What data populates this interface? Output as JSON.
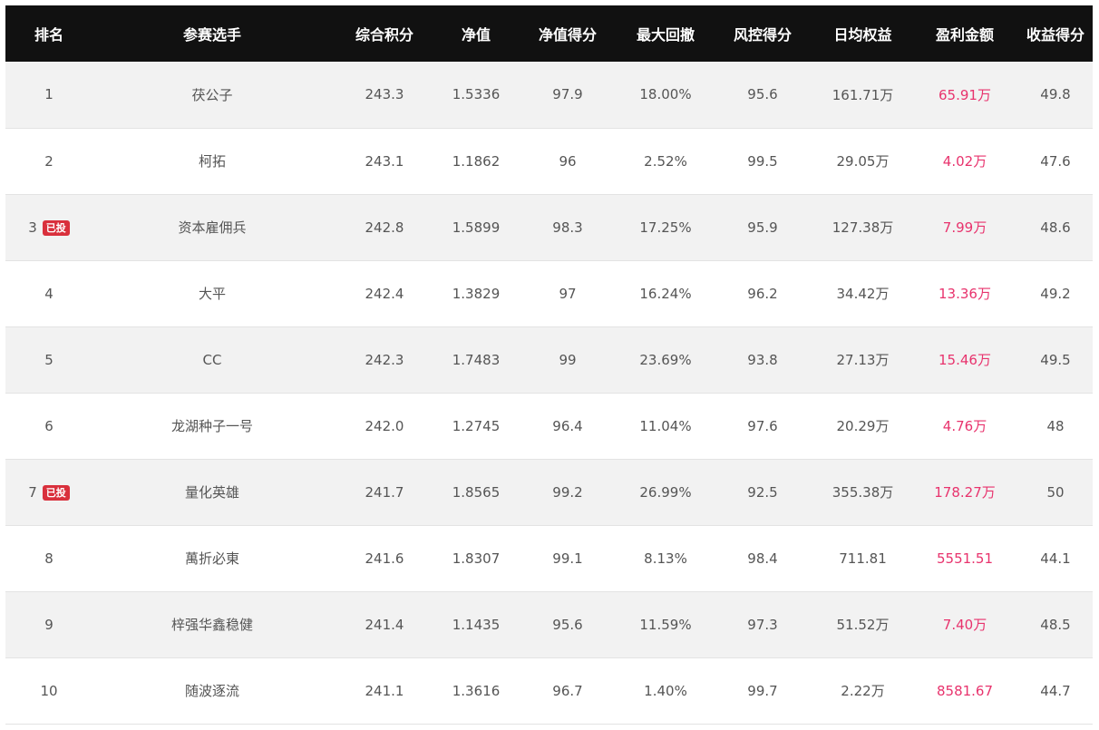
{
  "table": {
    "headers": [
      "排名",
      "参赛选手",
      "综合积分",
      "净值",
      "净值得分",
      "最大回撤",
      "风控得分",
      "日均权益",
      "盈利金额",
      "收益得分"
    ],
    "rows": [
      {
        "rank": "1",
        "badge": "",
        "name": "茯公子",
        "score": "243.3",
        "nav": "1.5336",
        "nav_score": "97.9",
        "drawdown": "18.00%",
        "risk_score": "95.6",
        "avg_equity": "161.71万",
        "profit": "65.91万",
        "return_score": "49.8"
      },
      {
        "rank": "2",
        "badge": "",
        "name": "柯拓",
        "score": "243.1",
        "nav": "1.1862",
        "nav_score": "96",
        "drawdown": "2.52%",
        "risk_score": "99.5",
        "avg_equity": "29.05万",
        "profit": "4.02万",
        "return_score": "47.6"
      },
      {
        "rank": "3",
        "badge": "已投",
        "name": "资本雇佣兵",
        "score": "242.8",
        "nav": "1.5899",
        "nav_score": "98.3",
        "drawdown": "17.25%",
        "risk_score": "95.9",
        "avg_equity": "127.38万",
        "profit": "7.99万",
        "return_score": "48.6"
      },
      {
        "rank": "4",
        "badge": "",
        "name": "大平",
        "score": "242.4",
        "nav": "1.3829",
        "nav_score": "97",
        "drawdown": "16.24%",
        "risk_score": "96.2",
        "avg_equity": "34.42万",
        "profit": "13.36万",
        "return_score": "49.2"
      },
      {
        "rank": "5",
        "badge": "",
        "name": "CC",
        "score": "242.3",
        "nav": "1.7483",
        "nav_score": "99",
        "drawdown": "23.69%",
        "risk_score": "93.8",
        "avg_equity": "27.13万",
        "profit": "15.46万",
        "return_score": "49.5"
      },
      {
        "rank": "6",
        "badge": "",
        "name": "龙湖种子一号",
        "score": "242.0",
        "nav": "1.2745",
        "nav_score": "96.4",
        "drawdown": "11.04%",
        "risk_score": "97.6",
        "avg_equity": "20.29万",
        "profit": "4.76万",
        "return_score": "48"
      },
      {
        "rank": "7",
        "badge": "已投",
        "name": "量化英雄",
        "score": "241.7",
        "nav": "1.8565",
        "nav_score": "99.2",
        "drawdown": "26.99%",
        "risk_score": "92.5",
        "avg_equity": "355.38万",
        "profit": "178.27万",
        "return_score": "50"
      },
      {
        "rank": "8",
        "badge": "",
        "name": "萬折必東",
        "score": "241.6",
        "nav": "1.8307",
        "nav_score": "99.1",
        "drawdown": "8.13%",
        "risk_score": "98.4",
        "avg_equity": "711.81",
        "profit": "5551.51",
        "return_score": "44.1"
      },
      {
        "rank": "9",
        "badge": "",
        "name": "梓强华鑫稳健",
        "score": "241.4",
        "nav": "1.1435",
        "nav_score": "95.6",
        "drawdown": "11.59%",
        "risk_score": "97.3",
        "avg_equity": "51.52万",
        "profit": "7.40万",
        "return_score": "48.5"
      },
      {
        "rank": "10",
        "badge": "",
        "name": "随波逐流",
        "score": "241.1",
        "nav": "1.3616",
        "nav_score": "96.7",
        "drawdown": "1.40%",
        "risk_score": "99.7",
        "avg_equity": "2.22万",
        "profit": "8581.67",
        "return_score": "44.7"
      }
    ]
  },
  "colors": {
    "header_bg": "#111111",
    "row_alt_bg": "#f2f2f2",
    "profit_text": "#e8336d",
    "badge_bg": "#d9303c"
  }
}
